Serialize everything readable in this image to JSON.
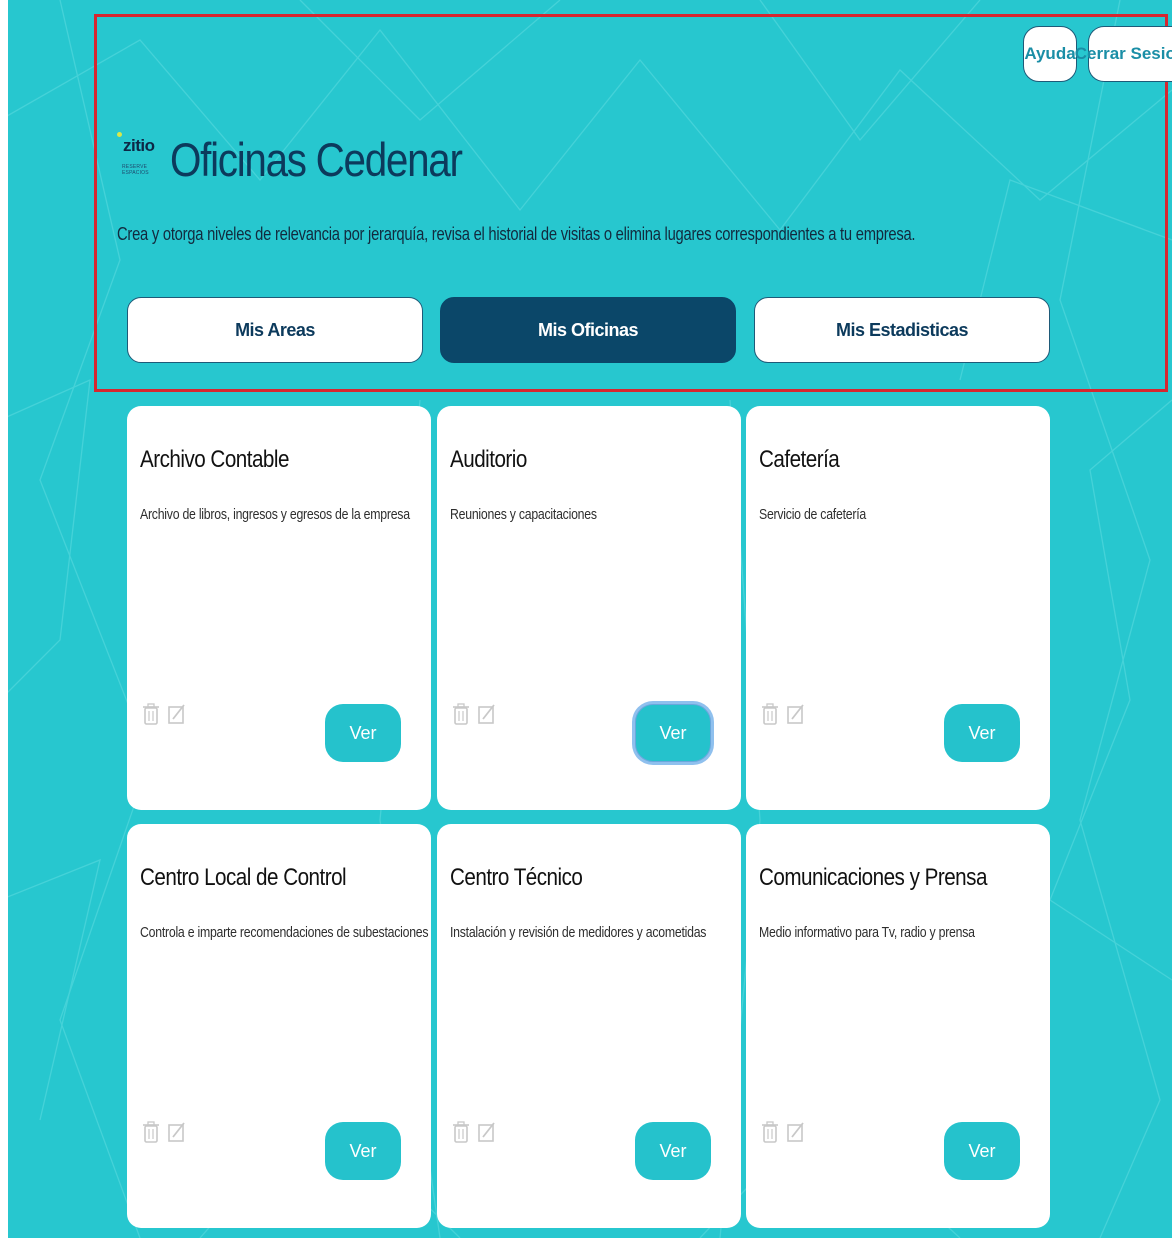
{
  "header": {
    "help_label": "Ayuda",
    "logout_label": "Cerrar Sesion",
    "logo": {
      "brand": "zitio",
      "tagline": "RESERVE ESPACIOS"
    },
    "title": "Oficinas Cedenar",
    "subtitle": "Crea y otorga niveles de relevancia por jerarquía, revisa el historial de visitas o elimina lugares correspondientes a tu empresa."
  },
  "tabs": [
    {
      "label": "Mis Areas",
      "active": false
    },
    {
      "label": "Mis Oficinas",
      "active": true
    },
    {
      "label": "Mis Estadisticas",
      "active": false
    }
  ],
  "offices": [
    {
      "name": "Archivo Contable",
      "description": "Archivo de libros, ingresos y egresos de la empresa",
      "button": "Ver"
    },
    {
      "name": "Auditorio",
      "description": "Reuniones y capacitaciones",
      "button": "Ver"
    },
    {
      "name": "Cafetería",
      "description": "Servicio de cafetería",
      "button": "Ver"
    },
    {
      "name": "Centro Local de Control",
      "description": "Controla e imparte recomendaciones de subestaciones",
      "button": "Ver"
    },
    {
      "name": "Centro Técnico",
      "description": "Instalación y revisión de medidores y acometidas",
      "button": "Ver"
    },
    {
      "name": "Comunicaciones y Prensa",
      "description": "Medio informativo para Tv, radio y prensa",
      "button": "Ver"
    }
  ],
  "icons": {
    "delete": "trash-icon",
    "edit": "edit-icon"
  },
  "colors": {
    "background": "#27c7cf",
    "primary_dark": "#0b4769",
    "accent": "#25c2cc",
    "highlight_border": "#d6262f"
  }
}
